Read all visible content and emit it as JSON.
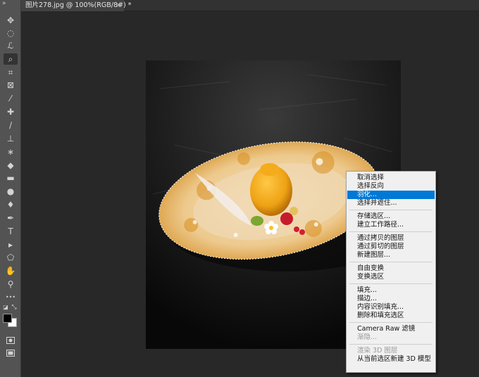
{
  "window": {
    "tab_title": "图片278.jpg @ 100%(RGB/8#) *",
    "tab_close": "×",
    "toolbar_collapse": "»"
  },
  "tools": [
    {
      "icon": "move-icon",
      "glyph": "✥"
    },
    {
      "icon": "marquee-icon",
      "glyph": "◌"
    },
    {
      "icon": "lasso-icon",
      "glyph": "ℒ"
    },
    {
      "icon": "quick-selection-icon",
      "glyph": "⌕",
      "active": true
    },
    {
      "icon": "crop-icon",
      "glyph": "⌗"
    },
    {
      "icon": "frame-icon",
      "glyph": "⊠"
    },
    {
      "icon": "eyedropper-icon",
      "glyph": "⁄"
    },
    {
      "icon": "healing-brush-icon",
      "glyph": "✚"
    },
    {
      "icon": "brush-icon",
      "glyph": "∕"
    },
    {
      "icon": "clone-stamp-icon",
      "glyph": "⊥"
    },
    {
      "icon": "history-brush-icon",
      "glyph": "∗"
    },
    {
      "icon": "eraser-icon",
      "glyph": "◆"
    },
    {
      "icon": "gradient-icon",
      "glyph": "▬"
    },
    {
      "icon": "blur-icon",
      "glyph": "●"
    },
    {
      "icon": "dodge-icon",
      "glyph": "♦"
    },
    {
      "icon": "pen-icon",
      "glyph": "✒"
    },
    {
      "icon": "type-icon",
      "glyph": "T"
    },
    {
      "icon": "path-selection-icon",
      "glyph": "▸"
    },
    {
      "icon": "shape-icon",
      "glyph": "⬠"
    },
    {
      "icon": "hand-icon",
      "glyph": "✋"
    },
    {
      "icon": "zoom-icon",
      "glyph": "⚲"
    },
    {
      "icon": "more-tools-icon",
      "glyph": "•••"
    }
  ],
  "colors": {
    "foreground": "#000000",
    "background": "#ffffff",
    "menu_highlight": "#0078d7",
    "plate": "#f2dfbf",
    "plate_glaze": "#e2a23e",
    "mango": "#f2a817"
  },
  "context_menu": {
    "items": [
      {
        "label": "取消选择"
      },
      {
        "label": "选择反向"
      },
      {
        "label": "羽化...",
        "selected": true
      },
      {
        "label": "选择并遮住..."
      },
      {
        "separator": true
      },
      {
        "label": "存储选区..."
      },
      {
        "label": "建立工作路径..."
      },
      {
        "separator": true
      },
      {
        "label": "通过拷贝的图层"
      },
      {
        "label": "通过剪切的图层"
      },
      {
        "label": "新建图层..."
      },
      {
        "separator": true
      },
      {
        "label": "自由变换"
      },
      {
        "label": "变换选区"
      },
      {
        "separator": true
      },
      {
        "label": "填充..."
      },
      {
        "label": "描边..."
      },
      {
        "label": "内容识别填充..."
      },
      {
        "label": "删除和填充选区"
      },
      {
        "separator": true
      },
      {
        "label": "Camera Raw 滤镜"
      },
      {
        "label": "渐隐...",
        "disabled": true
      },
      {
        "separator": true
      },
      {
        "label": "渲染 3D 图层",
        "disabled": true
      },
      {
        "label": "从当前选区新建 3D 模型"
      }
    ]
  }
}
